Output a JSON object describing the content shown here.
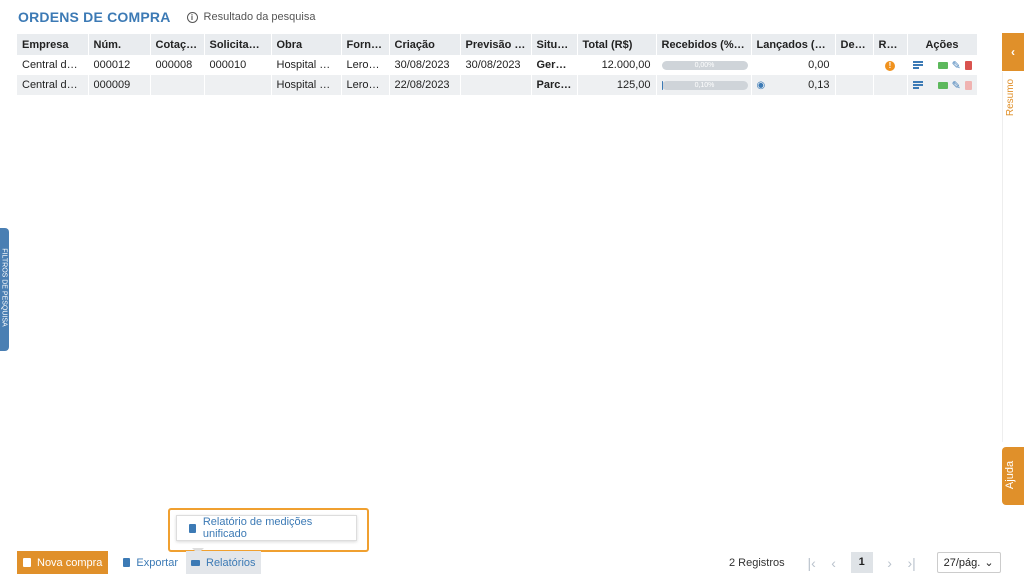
{
  "header": {
    "title": "ORDENS DE COMPRA",
    "subtitle": "Resultado da pesquisa"
  },
  "table": {
    "columns": [
      "Empresa",
      "Núm.",
      "Cotação",
      "Solicitação",
      "Obra",
      "Forne...",
      "Criação",
      "Previsão d...",
      "Situaç...",
      "Total (R$)",
      "Recebidos (%)",
      "Lançados (R$)",
      "Desc.",
      "Reg...",
      "Ações"
    ],
    "rows": [
      {
        "empresa": "Central de ...",
        "num": "000012",
        "cotacao": "000008",
        "solicitacao": "000010",
        "obra": "Hospital Gr...",
        "fornecedor": "Leroy ...",
        "criacao": "30/08/2023",
        "previsao": "30/08/2023",
        "situacao": "Gerada",
        "total": "12.000,00",
        "recebidos": "0,00%",
        "recebidos_fraction": 0.0,
        "lancados": "0,00",
        "desc": "",
        "reg": "!"
      },
      {
        "empresa": "Central de ...",
        "num": "000009",
        "cotacao": "",
        "solicitacao": "",
        "obra": "Hospital Gr...",
        "fornecedor": "Leroy ...",
        "criacao": "22/08/2023",
        "previsao": "",
        "situacao": "Parcia...",
        "total": "125,00",
        "recebidos": "0,10%",
        "recebidos_fraction": 0.001,
        "lancados": "0,13",
        "desc": "",
        "reg": ""
      }
    ]
  },
  "side": {
    "left_tab": "FILTROS DE PESQUISA",
    "right_toggle": "‹",
    "resumo": "Resumo",
    "ajuda": "Ajuda"
  },
  "popup": {
    "item": "Relatório de medições unificado"
  },
  "footer": {
    "new_purchase": "Nova compra",
    "export": "Exportar",
    "reports": "Relatórios",
    "count": "2 Registros",
    "first": "|‹",
    "prev": "‹",
    "page": "1",
    "next": "›",
    "last": "›|",
    "per_page": "27/pág.",
    "per_page_chevron": "⌄"
  },
  "colors": {
    "accent_blue": "#3c7ab5",
    "accent_orange": "#e0902a",
    "status_green": "#4f7a1f",
    "danger_red": "#d9534f"
  }
}
